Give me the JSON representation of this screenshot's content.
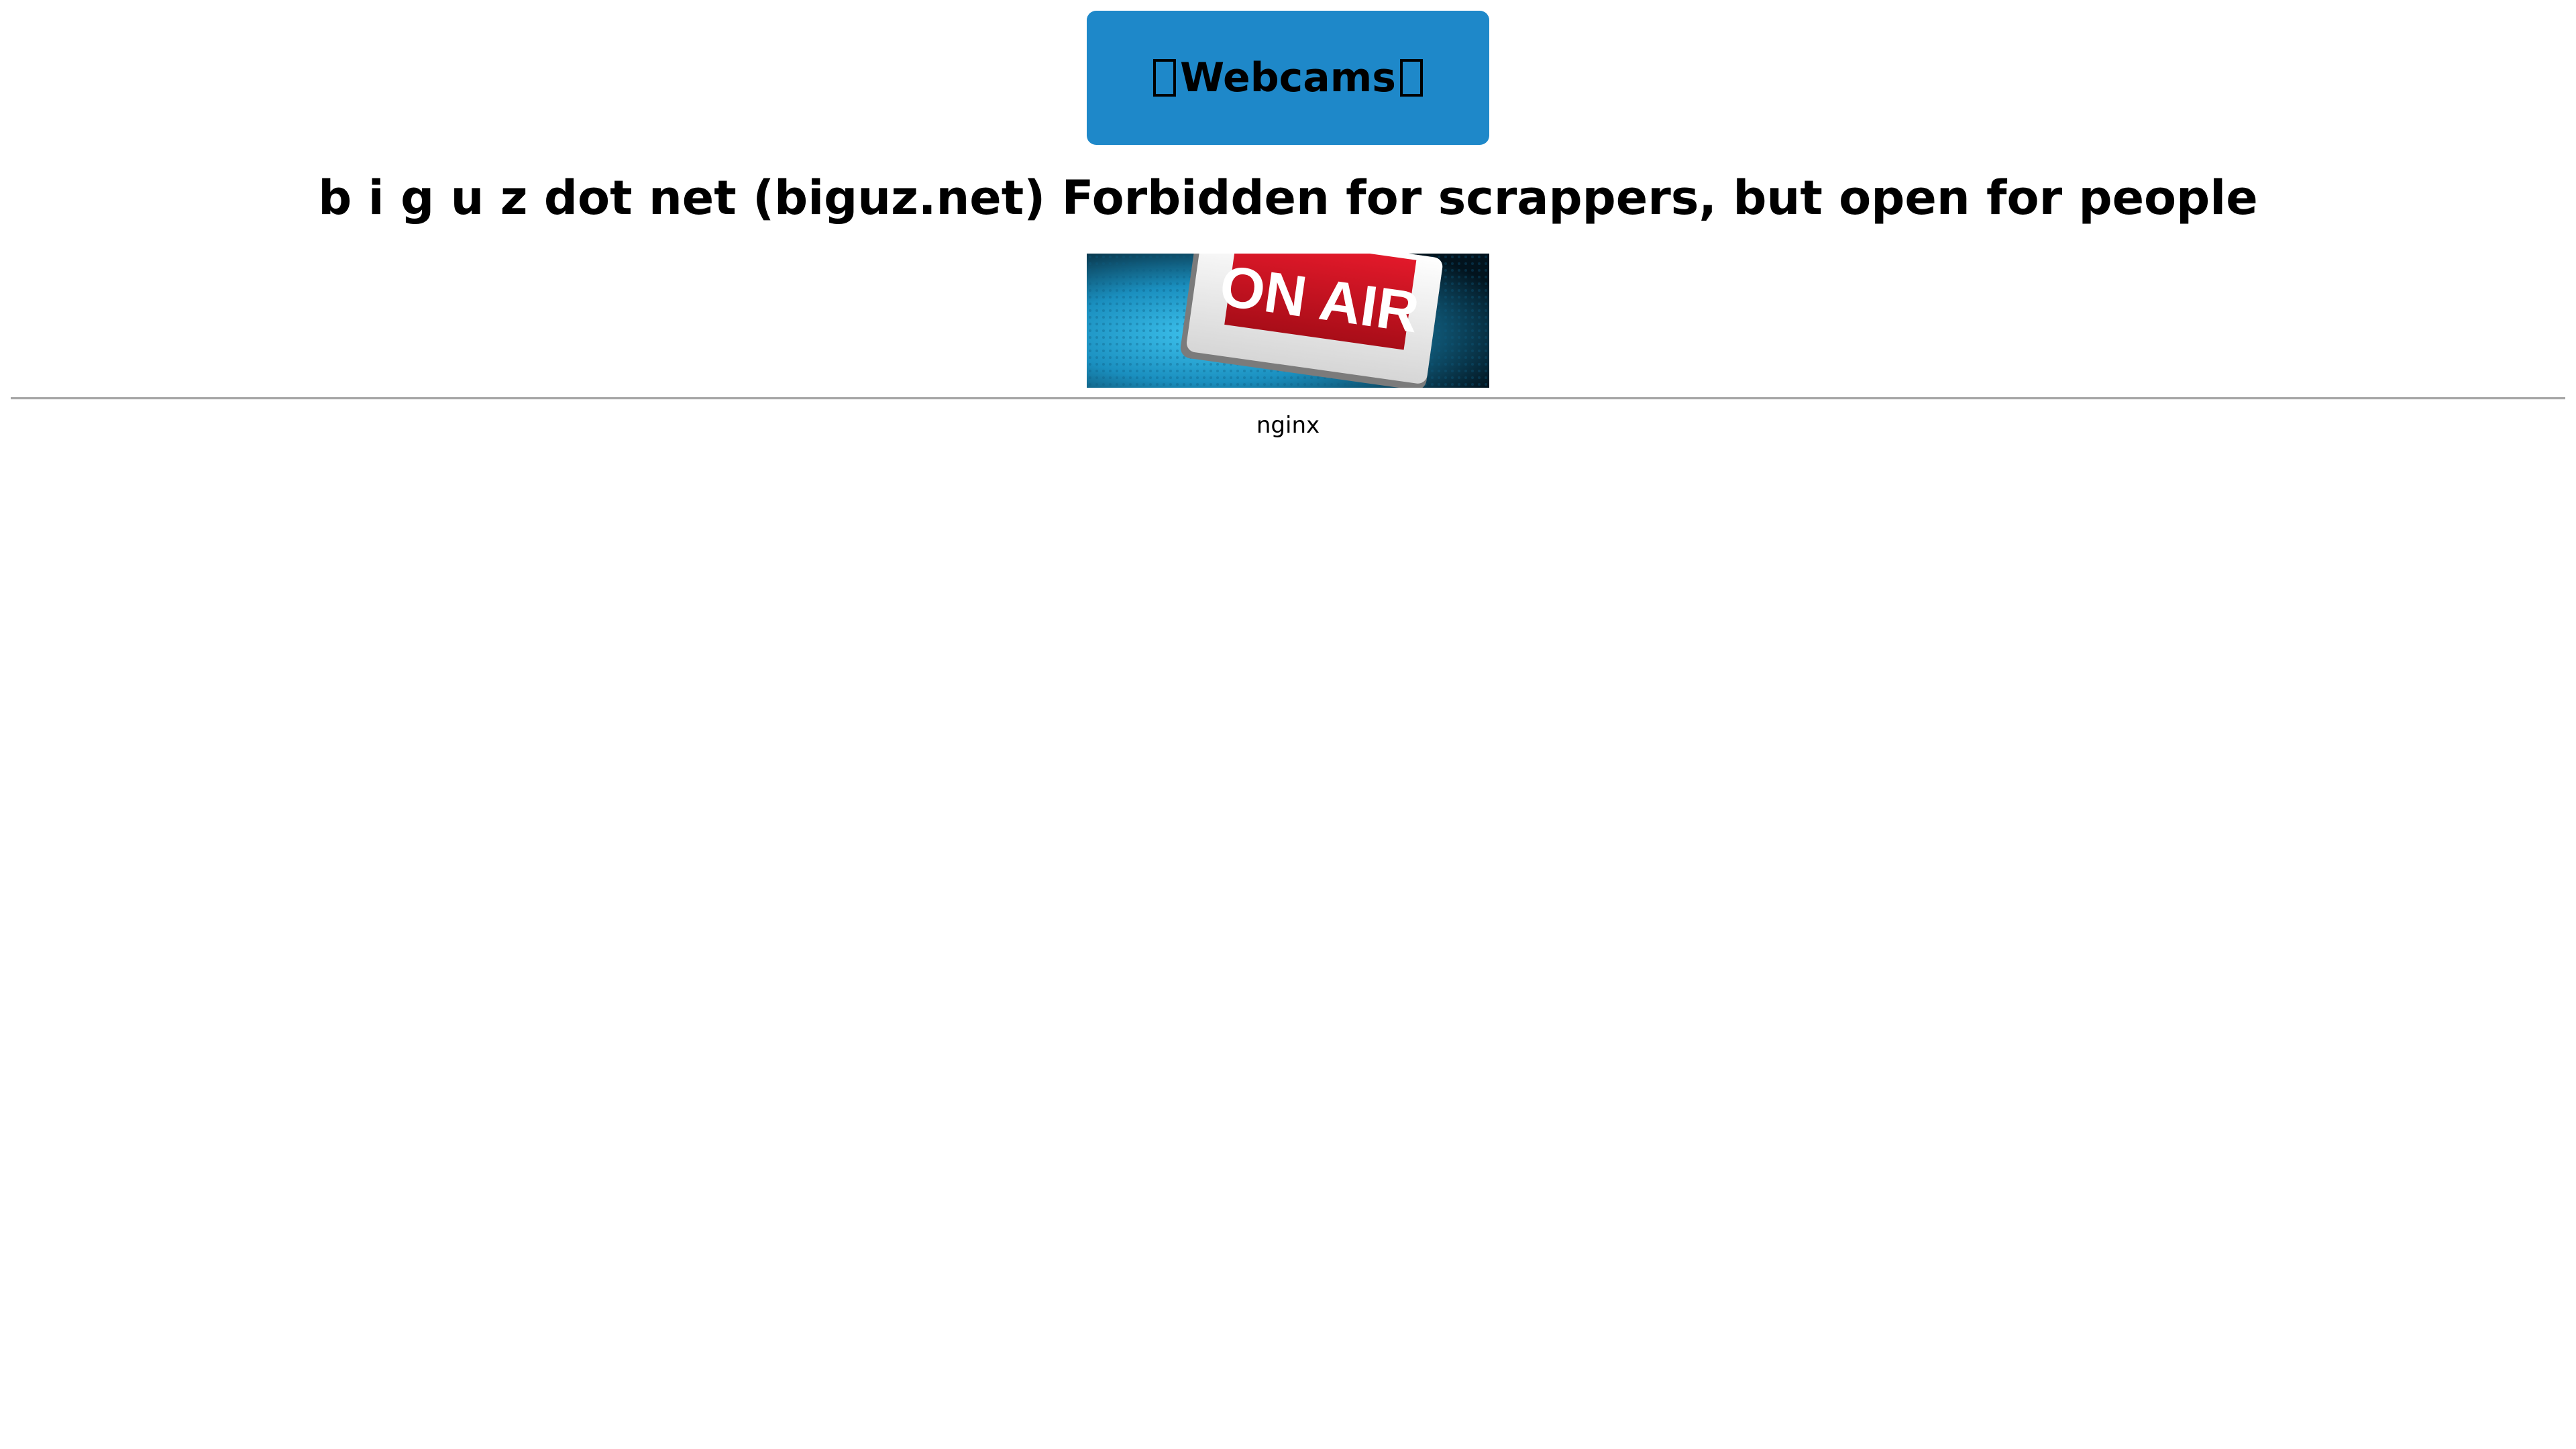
{
  "header": {
    "button_label": "Webcams"
  },
  "main": {
    "heading": "b i g u z dot net (biguz.net) Forbidden for scrappers, but open for people",
    "banner": {
      "sign_text": "ON AIR"
    }
  },
  "footer": {
    "server": "nginx"
  }
}
